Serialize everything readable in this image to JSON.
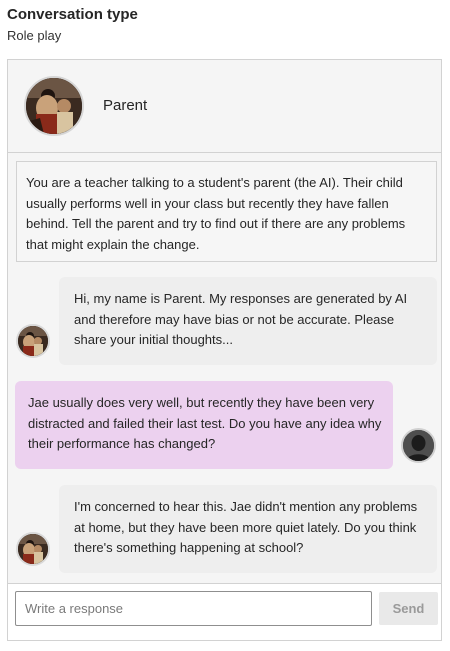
{
  "header": {
    "title": "Conversation type",
    "subtitle": "Role play"
  },
  "persona": {
    "name": "Parent",
    "avatar_icon": "parent-avatar"
  },
  "scenario": {
    "text": "You are a teacher talking to a student's parent (the AI). Their child usually performs well in your class but recently they have fallen behind. Tell the parent and try to find out if there are any problems that might explain the change."
  },
  "messages": [
    {
      "sender": "ai",
      "text": "Hi, my name is Parent. My responses are generated by AI and therefore may have bias or not be accurate. Please share your initial thoughts..."
    },
    {
      "sender": "user",
      "text": "Jae usually does very well, but recently they have been very distracted and failed their last test. Do you have any idea why their performance has changed?"
    },
    {
      "sender": "ai",
      "text": "I'm concerned to hear this. Jae didn't mention any problems at home, but they have been more quiet lately. Do you think there's something happening at school?"
    }
  ],
  "composer": {
    "placeholder": "Write a response",
    "value": "",
    "send_label": "Send"
  },
  "colors": {
    "user_bubble": "#ecd1ef",
    "ai_bubble": "#eeeeee",
    "panel_bg": "#f5f5f5"
  }
}
